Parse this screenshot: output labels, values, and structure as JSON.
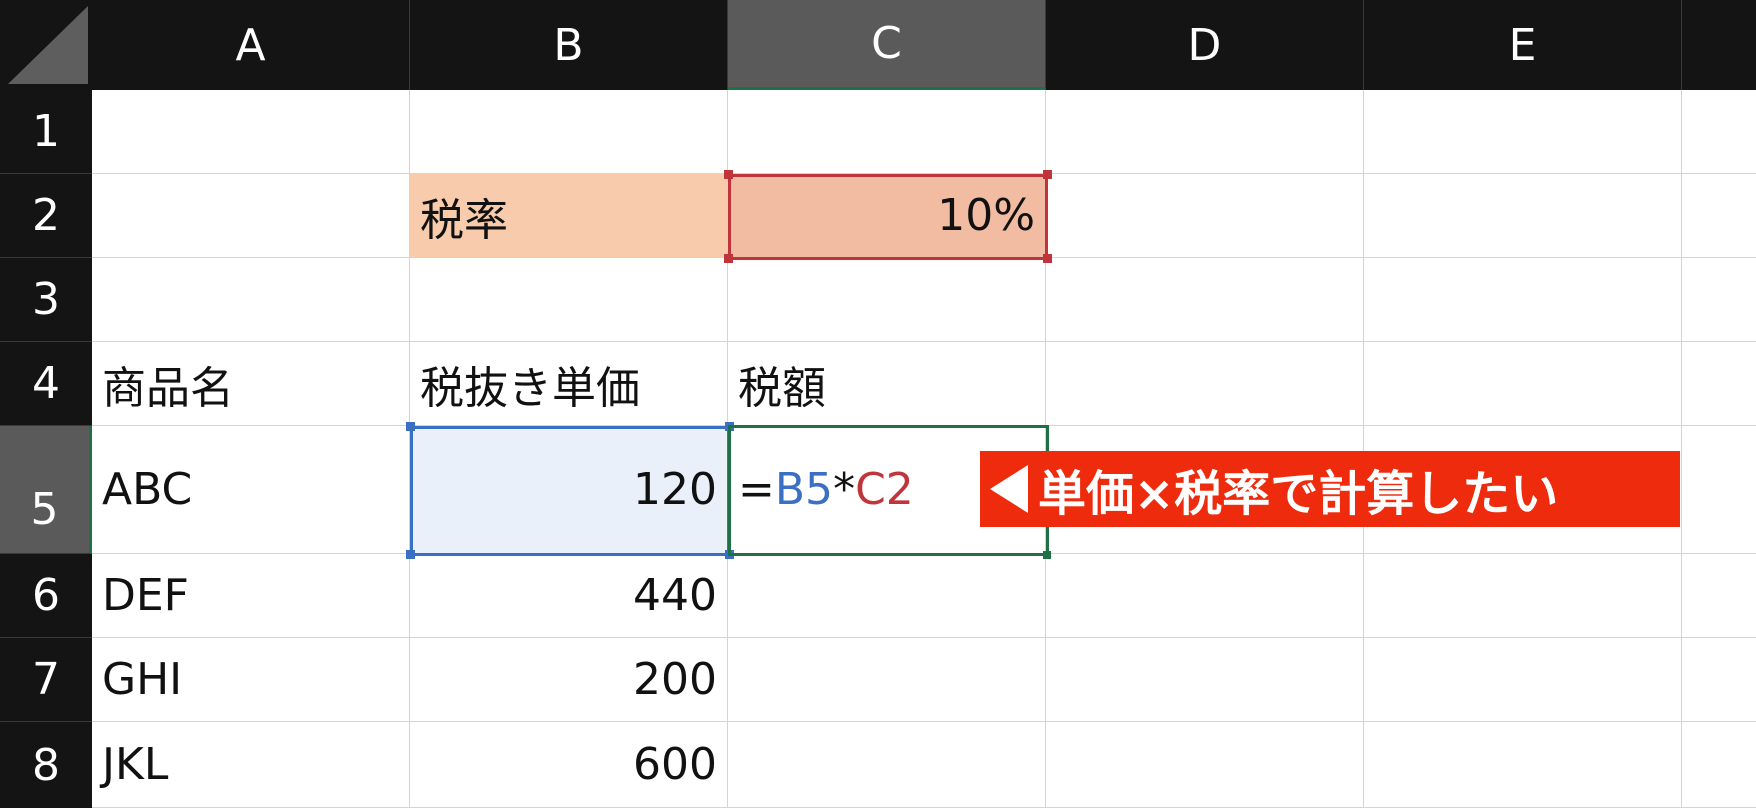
{
  "columns": [
    "A",
    "B",
    "C",
    "D",
    "E"
  ],
  "rows": [
    "1",
    "2",
    "3",
    "4",
    "5",
    "6",
    "7",
    "8"
  ],
  "cells": {
    "B2": "税率",
    "C2": "10%",
    "A4": "商品名",
    "B4": "税抜き単価",
    "C4": "税額",
    "A5": "ABC",
    "B5": "120",
    "A6": "DEF",
    "B6": "440",
    "A7": "GHI",
    "B7": "200",
    "A8": "JKL",
    "B8": "600"
  },
  "formula": {
    "equals": "=",
    "ref1": "B5",
    "op": "*",
    "ref2": "C2"
  },
  "callout": "単価×税率で計算したい",
  "colors": {
    "header_bg": "#141414",
    "header_selected_bg": "#5a5a5a",
    "accent_green": "#1e7145",
    "ref_blue": "#3a6fc4",
    "ref_red": "#c0353c",
    "label_fill": "#f8cbad",
    "rate_fill": "#f2bca3",
    "selected_fill": "#eaf0fa",
    "callout_bg": "#ee2b0c"
  }
}
